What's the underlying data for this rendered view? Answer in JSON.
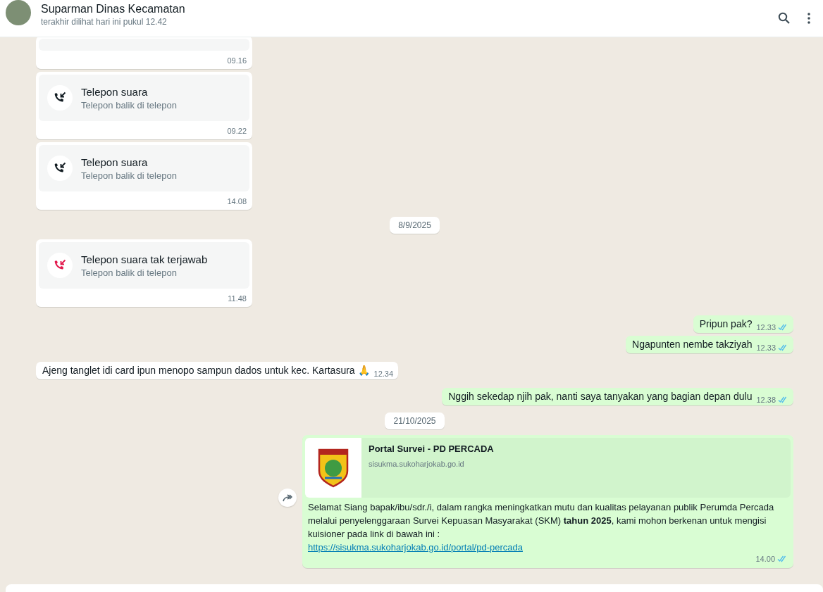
{
  "header": {
    "contact_name": "Suparman Dinas Kecamatan",
    "status": "terakhir dilihat hari ini pukul 12.42"
  },
  "messages": [
    {
      "kind": "call_cut",
      "outgoing": false,
      "time": "09.16"
    },
    {
      "kind": "call",
      "outgoing": false,
      "missed": false,
      "title": "Telepon suara",
      "subtitle": "Telepon balik di telepon",
      "time": "09.22"
    },
    {
      "kind": "call",
      "outgoing": false,
      "missed": false,
      "title": "Telepon suara",
      "subtitle": "Telepon balik di telepon",
      "time": "14.08"
    },
    {
      "kind": "date",
      "text": "8/9/2025"
    },
    {
      "kind": "call",
      "outgoing": false,
      "missed": true,
      "title": "Telepon suara tak terjawab",
      "subtitle": "Telepon balik di telepon",
      "time": "11.48"
    },
    {
      "kind": "text",
      "outgoing": true,
      "text": "Pripun pak?",
      "time": "12.33",
      "read": true
    },
    {
      "kind": "text",
      "outgoing": true,
      "text": "Ngapunten nembe takziyah",
      "time": "12.33",
      "read": true
    },
    {
      "kind": "text",
      "outgoing": false,
      "text": "Ajeng tanglet idi card ipun menopo sampun dados untuk kec. Kartasura 🙏",
      "time": "12.34"
    },
    {
      "kind": "text",
      "outgoing": true,
      "text": "Nggih sekedap njih pak, nanti saya tanyakan yang bagian depan dulu",
      "time": "12.38",
      "read": true
    },
    {
      "kind": "date",
      "text": "21/10/2025"
    },
    {
      "kind": "link",
      "outgoing": true,
      "forwardable": true,
      "preview_title": "Portal Survei - PD PERCADA",
      "preview_domain": "sisukma.sukoharjokab.go.id",
      "text": "Selamat Siang bapak/ibu/sdr./i, dalam rangka meningkatkan mutu dan kualitas pelayanan publik Perumda Percada melalui penyelenggaraan Survei Kepuasan Masyarakat (SKM) **tahun 2025**, kami mohon berkenan untuk mengisi kuisioner pada link di bawah ini :",
      "link": "https://sisukma.sukoharjokab.go.id/portal/pd-percada",
      "time": "14.00",
      "read": true
    }
  ]
}
